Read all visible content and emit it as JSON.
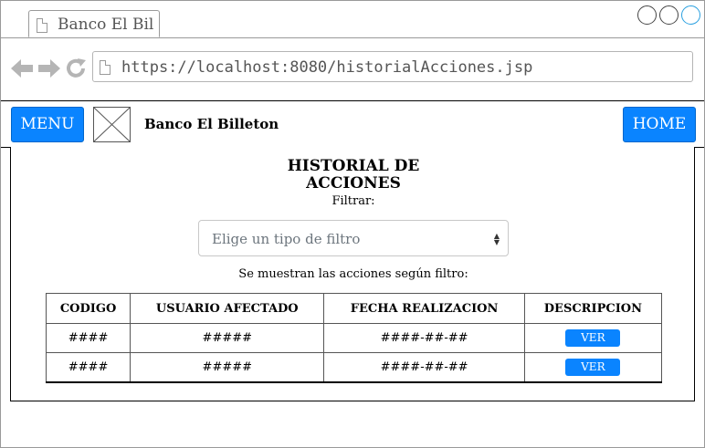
{
  "browser": {
    "tab_title": "Banco El Bil",
    "url": "https://localhost:8080/historialAcciones.jsp"
  },
  "nav": {
    "menu_label": "MENU",
    "brand": "Banco El Billeton",
    "home_label": "HOME"
  },
  "page": {
    "title_line1": "HISTORIAL DE",
    "title_line2": "ACCIONES",
    "filter_label": "Filtrar:",
    "filter_placeholder": "Elige un tipo de filtro",
    "subtitle": "Se muestran las acciones según filtro:"
  },
  "table": {
    "headers": [
      "CODIGO",
      "USUARIO AFECTADO",
      "FECHA REALIZACION",
      "DESCRIPCION"
    ],
    "rows": [
      {
        "codigo": "####",
        "usuario": "#####",
        "fecha": "####-##-##",
        "accion": "VER"
      },
      {
        "codigo": "####",
        "usuario": "#####",
        "fecha": "####-##-##",
        "accion": "VER"
      }
    ]
  },
  "colors": {
    "accent": "#0a84ff",
    "active_window_control": "#2aa0e0"
  },
  "icons": {
    "tab": "document-icon",
    "back": "back-arrow-icon",
    "forward": "forward-arrow-icon",
    "reload": "reload-icon",
    "url": "document-icon",
    "logo": "image-placeholder-icon",
    "select": "sort-caret-icon"
  }
}
